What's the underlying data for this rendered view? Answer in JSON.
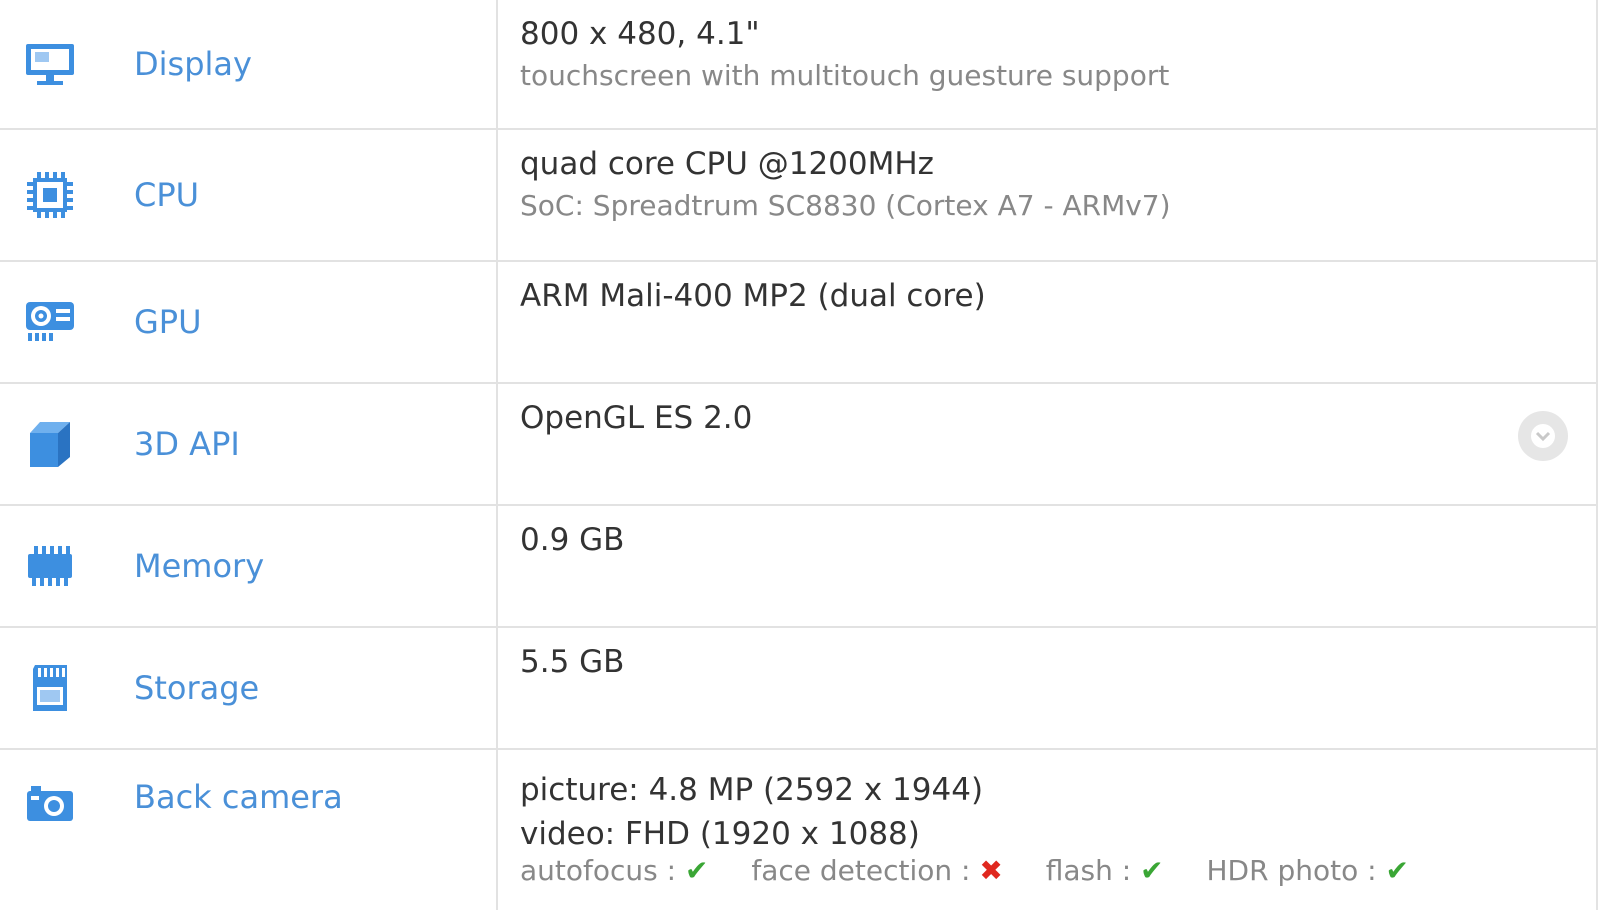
{
  "colors": {
    "label": "#4a90d8",
    "icon": "#3d8fe0",
    "ok": "#3aa635",
    "no": "#e0281f"
  },
  "rows": [
    {
      "icon": "monitor-icon",
      "label": "Display",
      "main": "800 x 480, 4.1\"",
      "sub": "touchscreen with multitouch guesture support"
    },
    {
      "icon": "chip-icon",
      "label": "CPU",
      "main": "quad core CPU @1200MHz",
      "sub": "SoC: Spreadtrum SC8830 (Cortex A7 - ARMv7)"
    },
    {
      "icon": "graphics-card-icon",
      "label": "GPU",
      "main": "ARM Mali-400 MP2 (dual core)"
    },
    {
      "icon": "cube-icon",
      "label": "3D API",
      "main": "OpenGL ES 2.0",
      "expand_icon": "chevron-down-icon"
    },
    {
      "icon": "ram-icon",
      "label": "Memory",
      "main": "0.9 GB"
    },
    {
      "icon": "sd-card-icon",
      "label": "Storage",
      "main": "5.5 GB"
    },
    {
      "icon": "camera-icon",
      "label": "Back camera",
      "main": "picture: 4.8 MP (2592 x 1944)",
      "sub": "video: FHD (1920 x 1088)",
      "features": [
        {
          "label": "autofocus :",
          "mark": "✔"
        },
        {
          "label": "face detection :",
          "mark": "✖"
        },
        {
          "label": "flash :",
          "mark": "✔"
        },
        {
          "label": "HDR photo :",
          "mark": "✔"
        }
      ]
    }
  ]
}
